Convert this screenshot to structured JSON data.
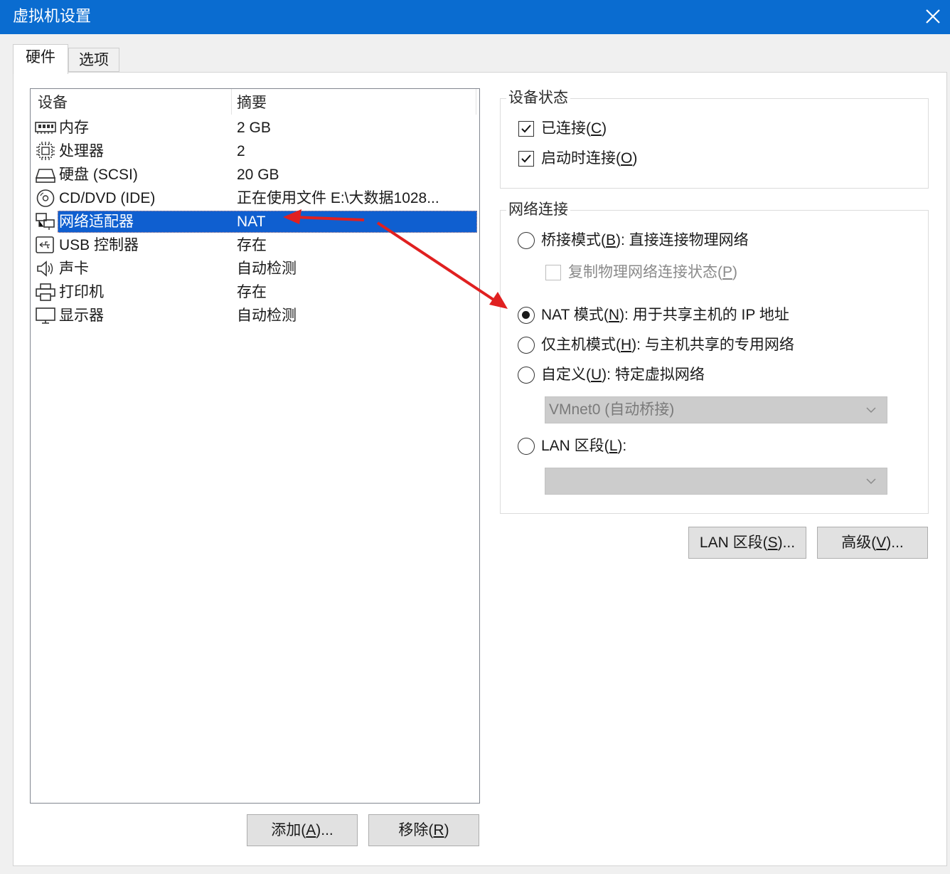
{
  "window": {
    "title": "虚拟机设置"
  },
  "tabs": [
    {
      "label": "硬件",
      "active": true
    },
    {
      "label": "选项",
      "active": false
    }
  ],
  "device_list": {
    "header_device": "设备",
    "header_summary": "摘要",
    "rows": [
      {
        "name": "内存",
        "summary": "2 GB",
        "icon": "memory-icon"
      },
      {
        "name": "处理器",
        "summary": "2",
        "icon": "cpu-icon"
      },
      {
        "name": "硬盘 (SCSI)",
        "summary": "20 GB",
        "icon": "harddisk-icon"
      },
      {
        "name": "CD/DVD (IDE)",
        "summary": "正在使用文件 E:\\大数据1028...",
        "icon": "cd-dvd-icon"
      },
      {
        "name": "网络适配器",
        "summary": "NAT",
        "icon": "network-adapter-icon",
        "selected": true
      },
      {
        "name": "USB 控制器",
        "summary": "存在",
        "icon": "usb-icon"
      },
      {
        "name": "声卡",
        "summary": "自动检测",
        "icon": "speaker-icon"
      },
      {
        "name": "打印机",
        "summary": "存在",
        "icon": "printer-icon"
      },
      {
        "name": "显示器",
        "summary": "自动检测",
        "icon": "monitor-icon"
      }
    ]
  },
  "buttons": {
    "add_prefix": "添加(",
    "add_key": "A",
    "add_suffix": ")...",
    "remove_prefix": "移除(",
    "remove_key": "R",
    "remove_suffix": ")",
    "lan_prefix": "LAN 区段(",
    "lan_key": "S",
    "lan_suffix": ")...",
    "adv_prefix": "高级(",
    "adv_key": "V",
    "adv_suffix": ")..."
  },
  "device_status": {
    "label": "设备状态",
    "connected": {
      "prefix": "已连接(",
      "key": "C",
      "suffix": ")",
      "checked": true
    },
    "connect_on_start": {
      "prefix": "启动时连接(",
      "key": "O",
      "suffix": ")",
      "checked": true
    }
  },
  "network": {
    "label": "网络连接",
    "bridged": {
      "prefix": "桥接模式(",
      "key": "B",
      "suffix": "): 直接连接物理网络",
      "selected": false
    },
    "replicate": {
      "prefix": "复制物理网络连接状态(",
      "key": "P",
      "suffix": ")",
      "checked": false,
      "disabled": true
    },
    "nat": {
      "prefix": "NAT 模式(",
      "key": "N",
      "suffix": "): 用于共享主机的 IP 地址",
      "selected": true
    },
    "hostonly": {
      "prefix": "仅主机模式(",
      "key": "H",
      "suffix": "): 与主机共享的专用网络",
      "selected": false
    },
    "custom": {
      "prefix": "自定义(",
      "key": "U",
      "suffix": "): 特定虚拟网络",
      "selected": false
    },
    "custom_select_value": "VMnet0 (自动桥接)",
    "lan": {
      "prefix": "LAN 区段(",
      "key": "L",
      "suffix": "):",
      "selected": false
    },
    "lan_select_value": ""
  },
  "colors": {
    "titlebar": "#0a6cd0",
    "selection": "#0f5fd0",
    "annotation_arrow": "#e02020"
  }
}
